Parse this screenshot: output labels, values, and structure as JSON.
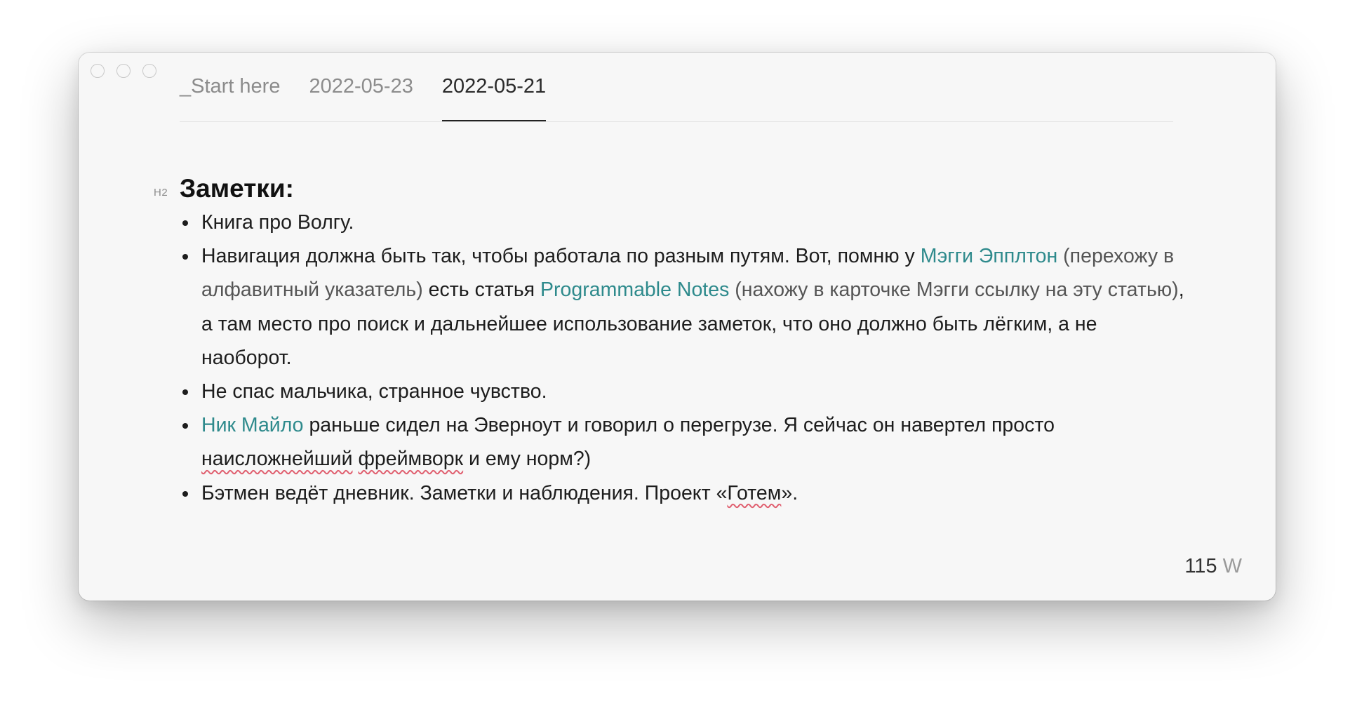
{
  "window": {
    "tabs": [
      {
        "label": "_Start here",
        "active": false
      },
      {
        "label": "2022-05-23",
        "active": false
      },
      {
        "label": "2022-05-21",
        "active": true
      }
    ]
  },
  "document": {
    "heading_marker": "H2",
    "heading": "Заметки:",
    "items": {
      "item1": {
        "text": "Книга про Волгу."
      },
      "item2": {
        "part1": "Навигация должна быть так, чтобы работала по разным путям. Вот, помню у ",
        "link1": "Мэгги Эпплтон",
        "part2": " (перехожу в алфавитный указатель)",
        "part3": " есть статья ",
        "link2": "Programmable Notes",
        "part4": " (нахожу в карточке Мэгги ссылку на эту статью)",
        "part5": ", а там место про поиск и дальнейшее использование заметок, что оно должно быть лёгким, а не наоборот."
      },
      "item3": {
        "text": "Не спас мальчика, странное чувство."
      },
      "item4": {
        "link": "Ник Майло",
        "part1": " раньше сидел на Эверноут и говорил о перегрузе. Я сейчас он навертел просто ",
        "word1": "наисложнейший",
        "space": " ",
        "word2": "фреймворк",
        "part2": " и ему норм?)"
      },
      "item5": {
        "part1": "Бэтмен ведёт дневник. Заметки и наблюдения. Проект «",
        "word": "Готем",
        "part2": "»."
      }
    }
  },
  "statusbar": {
    "word_count": "115",
    "unit": "W"
  },
  "colors": {
    "link": "#2e8a8c",
    "spellcheck": "#e06070",
    "window_bg": "#f7f7f7"
  }
}
